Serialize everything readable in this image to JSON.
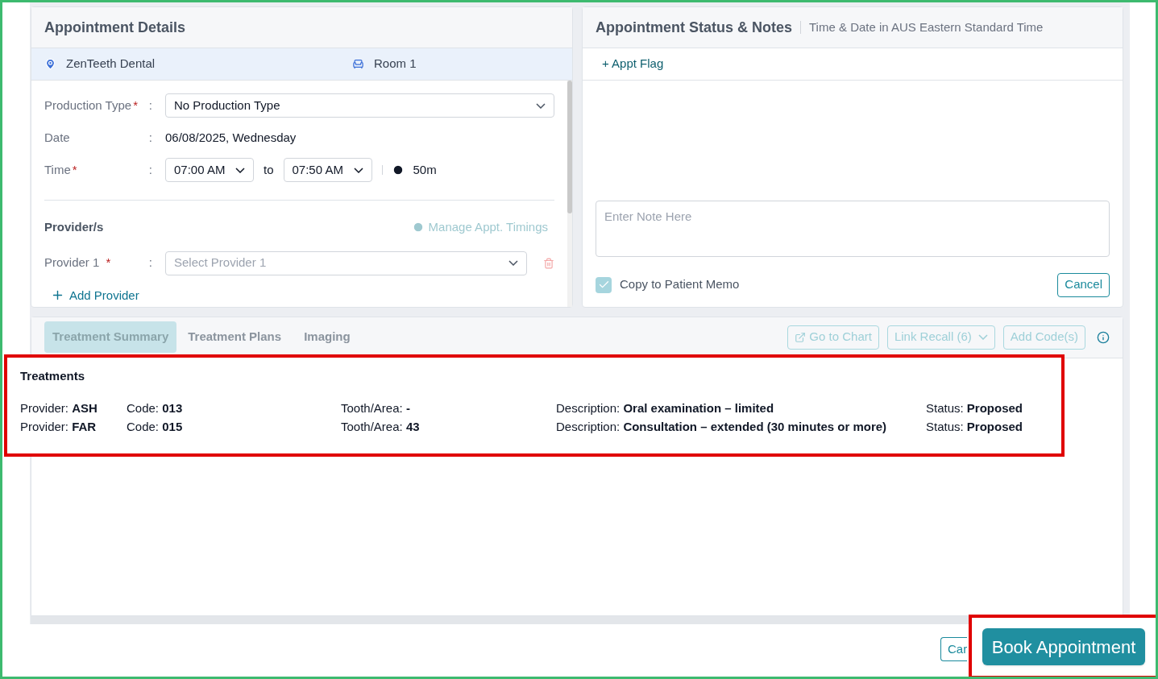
{
  "appointment_details": {
    "title": "Appointment Details",
    "location": "ZenTeeth Dental",
    "room": "Room 1",
    "fields": [
      {
        "kind": "select",
        "label": "Production Type",
        "required_mark": "*",
        "separator": ":",
        "value": "No Production Type"
      },
      {
        "kind": "text",
        "label": "Date",
        "separator": ":",
        "value": "06/08/2025, Wednesday"
      },
      {
        "kind": "time",
        "label": "Time",
        "required_mark": "*",
        "separator": ":",
        "start": "07:00 AM",
        "connector": "to",
        "end": "07:50 AM",
        "duration": "50m"
      }
    ],
    "providers": {
      "title": "Provider/s",
      "manage_link": "Manage Appt. Timings",
      "rows": [
        {
          "label": "Provider 1",
          "required_mark": "*",
          "separator": ":",
          "placeholder": "Select Provider 1"
        }
      ],
      "add_label": "Add Provider"
    }
  },
  "status_notes": {
    "title": "Appointment Status & Notes",
    "subtitle": "Time & Date in AUS Eastern Standard Time",
    "flag_link": "+ Appt Flag",
    "note_placeholder": "Enter Note Here",
    "copy_to_memo": {
      "label": "Copy to Patient Memo",
      "checked": true
    },
    "cancel": "Cancel"
  },
  "tabs": [
    {
      "label": "Treatment Summary",
      "selected": true
    },
    {
      "label": "Treatment Plans",
      "selected": false
    },
    {
      "label": "Imaging",
      "selected": false
    }
  ],
  "actions": [
    {
      "kind": "link",
      "label": "Go to Chart",
      "disabled": true
    },
    {
      "kind": "dropdown",
      "label": "Link Recall (6)",
      "disabled": true
    },
    {
      "kind": "plain",
      "label": "Add Code(s)",
      "disabled": true
    }
  ],
  "treatments": {
    "title": "Treatments",
    "rows": [
      [
        "Provider: **ASH**",
        "Code: **013**",
        "Tooth/Area: **-**",
        "Description: **Oral examination – limited**",
        "Status: **Proposed**"
      ],
      [
        "Provider: **FAR**",
        "Code: **015**",
        "Tooth/Area: **43**",
        "Description: **Consultation – extended (30 minutes or more)**",
        "Status: **Proposed**"
      ]
    ]
  },
  "footer": {
    "cancel_partial": "Car",
    "book": "Book Appointment"
  }
}
